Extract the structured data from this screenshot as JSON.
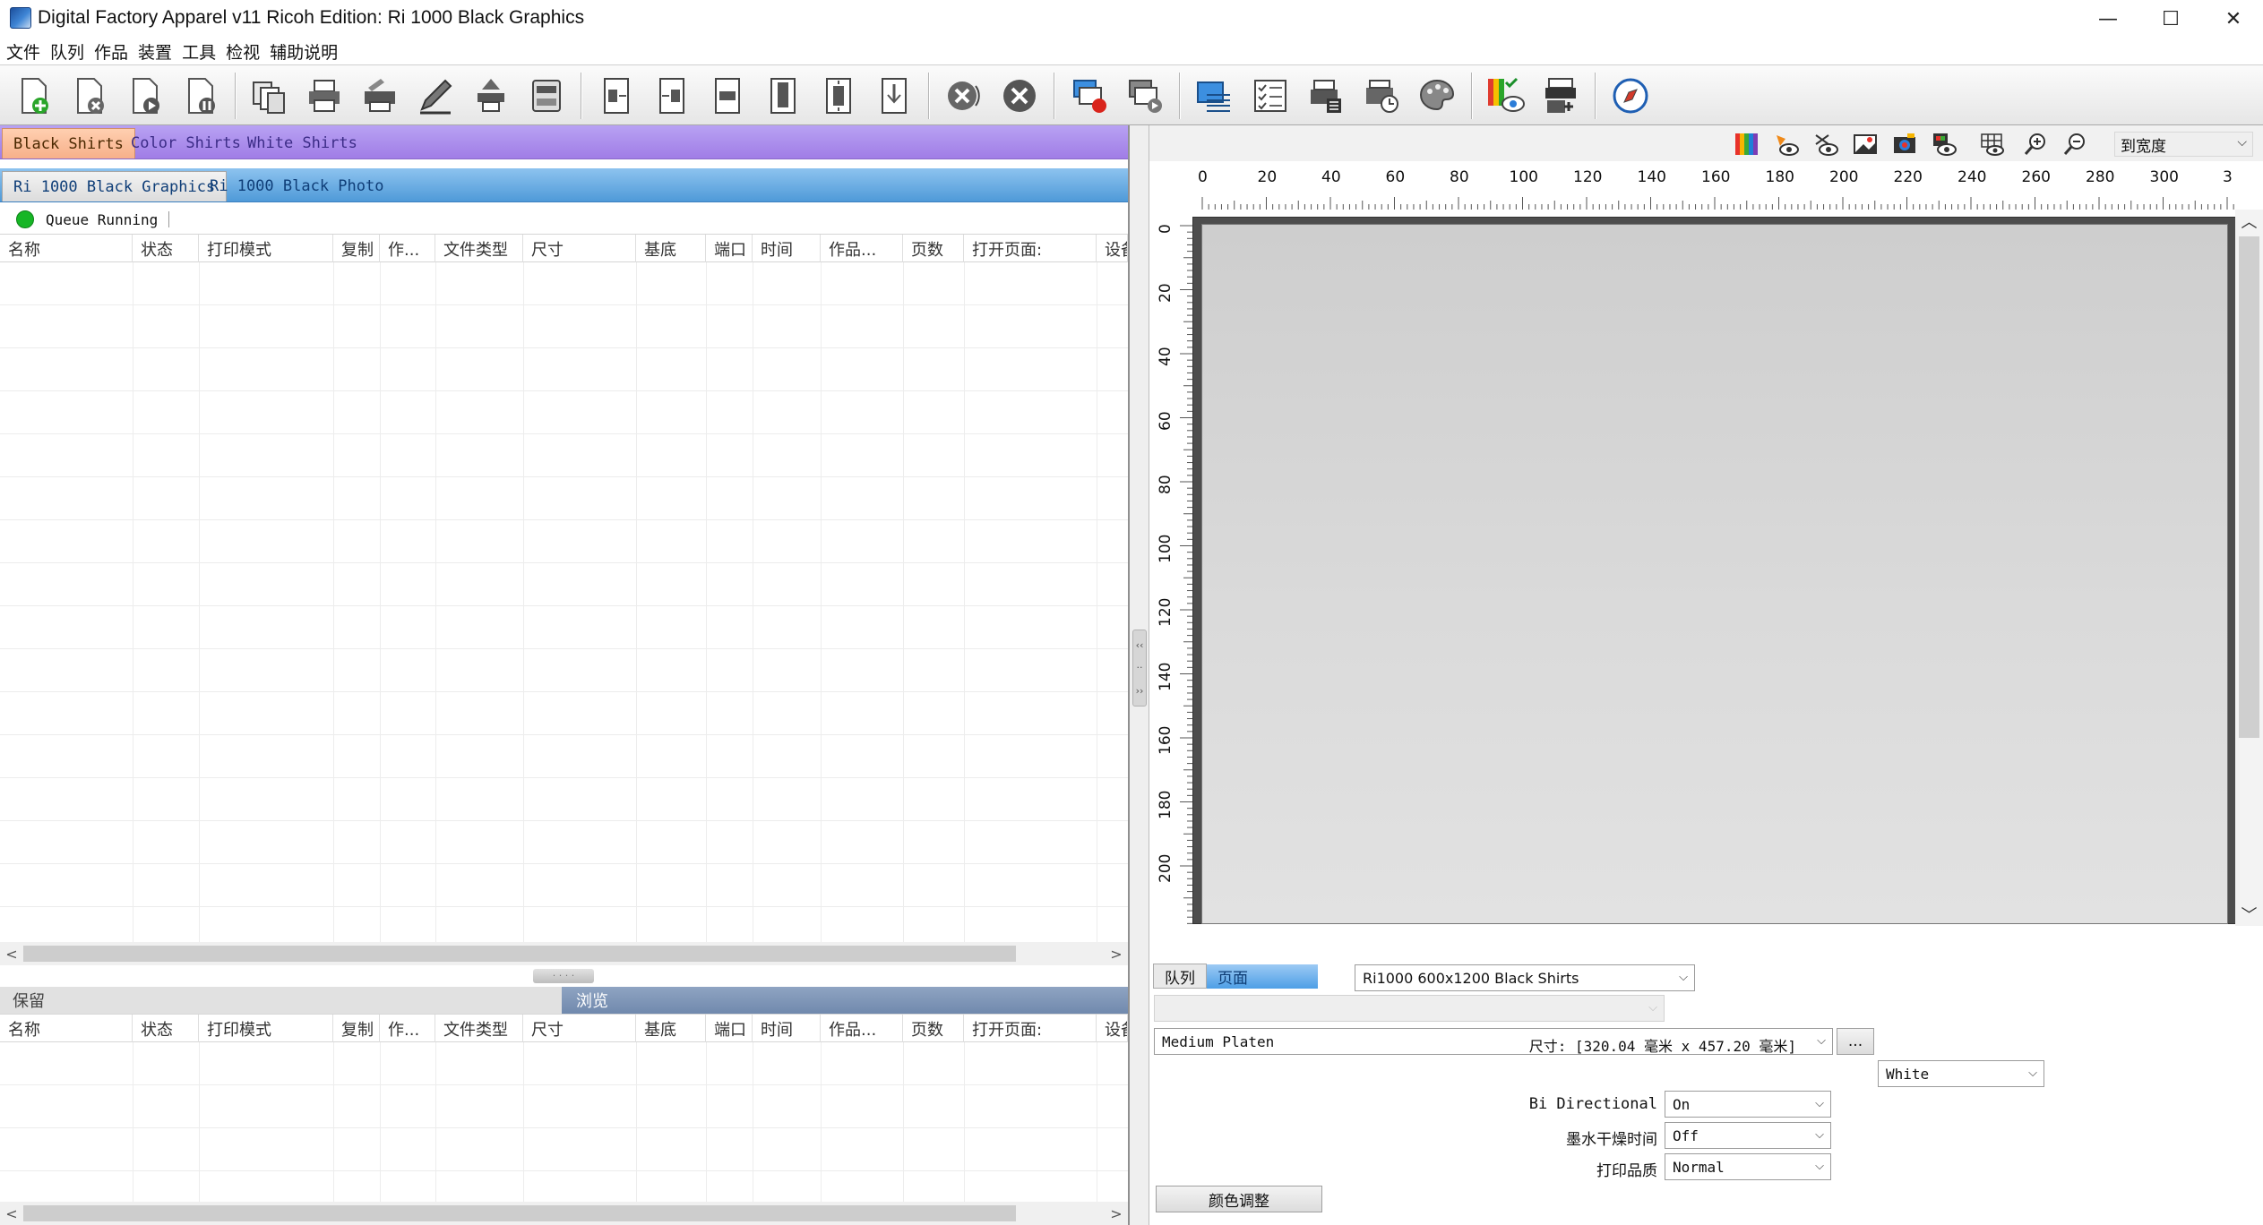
{
  "window": {
    "title": "Digital Factory Apparel v11 Ricoh Edition: Ri 1000 Black Graphics",
    "minimize": "—",
    "maximize": "☐",
    "close": "✕"
  },
  "menu": [
    "文件",
    "队列",
    "作品",
    "装置",
    "工具",
    "检视",
    "辅助说明"
  ],
  "queue_groups": {
    "tabs": [
      "Black Shirts",
      "Color Shirts",
      "White Shirts"
    ],
    "selected": "Black Shirts"
  },
  "queues": {
    "tabs": [
      "Ri 1000 Black Graphics",
      "Ri 1000 Black Photo"
    ],
    "selected": "Ri 1000 Black Graphics"
  },
  "status": {
    "text": "Queue Running",
    "color": "#17b626"
  },
  "job_table": {
    "columns": [
      "名称",
      "状态",
      "打印模式",
      "复制",
      "作...",
      "文件类型",
      "尺寸",
      "基底",
      "端口",
      "时间",
      "作品...",
      "页数",
      "打开页面:",
      "设备"
    ],
    "rows": []
  },
  "bottom_tabs": {
    "hold": "保留",
    "browse": "浏览"
  },
  "hold_table": {
    "columns": [
      "名称",
      "状态",
      "打印模式",
      "复制",
      "作...",
      "文件类型",
      "尺寸",
      "基底",
      "端口",
      "时间",
      "作品...",
      "页数",
      "打开页面:",
      "设备"
    ],
    "rows": []
  },
  "preview": {
    "zoom_option": "到宽度",
    "ruler_x": [
      "0",
      "20",
      "40",
      "60",
      "80",
      "100",
      "120",
      "140",
      "160",
      "180",
      "200",
      "220",
      "240",
      "260",
      "280",
      "300",
      "3"
    ],
    "ruler_y": [
      "0",
      "20",
      "40",
      "60",
      "80",
      "100",
      "120",
      "140",
      "160",
      "180",
      "200"
    ]
  },
  "settings": {
    "tab_queue": "队列",
    "tab_page": "页面",
    "print_mode": "Ri1000 600x1200 Black Shirts",
    "media_name": "Medium Platen",
    "media_size": "尺寸: [320.04 毫米 x 457.20 毫米]",
    "more_button": "...",
    "ink_set": "White",
    "bi_directional_label": "Bi Directional",
    "bi_directional_value": "On",
    "dry_time_label": "墨水干燥时间",
    "dry_time_value": "Off",
    "quality_label": "打印品质",
    "quality_value": "Normal",
    "color_adjust_button": "颜色调整"
  },
  "colors": {
    "queue_group_bar": "#a07de6",
    "queue_bar": "#4f9ad8",
    "selected_tab": "#f7b08a",
    "browse_tab": "#7089ad"
  }
}
